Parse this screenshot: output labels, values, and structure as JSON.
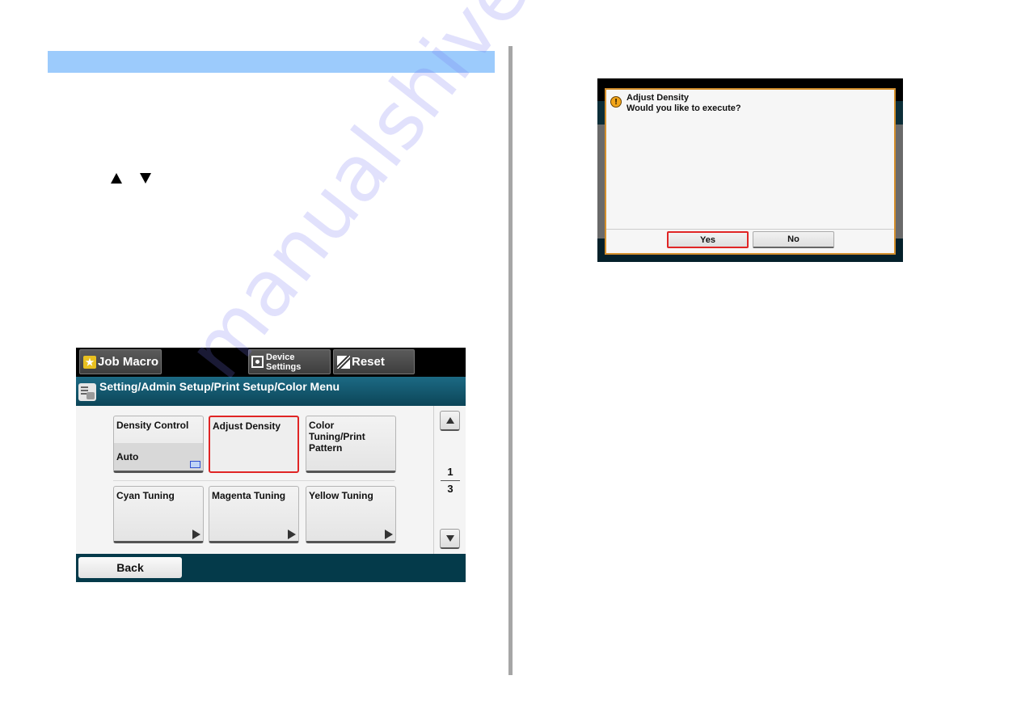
{
  "page": {
    "section_bar_color": "#9ccbfc",
    "arrow_keys": [
      "up-triangle",
      "down-triangle"
    ]
  },
  "panel1": {
    "topbar": {
      "job_macro": "Job Macro",
      "device_settings_line1": "Device",
      "device_settings_line2": "Settings",
      "reset": "Reset"
    },
    "title": "Setting/Admin Setup/Print Setup/Color Menu",
    "tiles": [
      {
        "label": "Density Control",
        "value": "Auto"
      },
      {
        "label": "Adjust Density",
        "selected": true
      },
      {
        "label": "Color Tuning/Print Pattern"
      },
      {
        "label": "Cyan Tuning"
      },
      {
        "label": "Magenta Tuning"
      },
      {
        "label": "Yellow Tuning"
      }
    ],
    "page_current": "1",
    "page_total": "3",
    "back": "Back",
    "highlight_color": "#e02525"
  },
  "panel2": {
    "dialog_title": "Adjust Density",
    "dialog_message": "Would you like to execute?",
    "yes": "Yes",
    "no": "No",
    "border_color": "#d48f2c"
  },
  "watermark": "manualshive.com"
}
